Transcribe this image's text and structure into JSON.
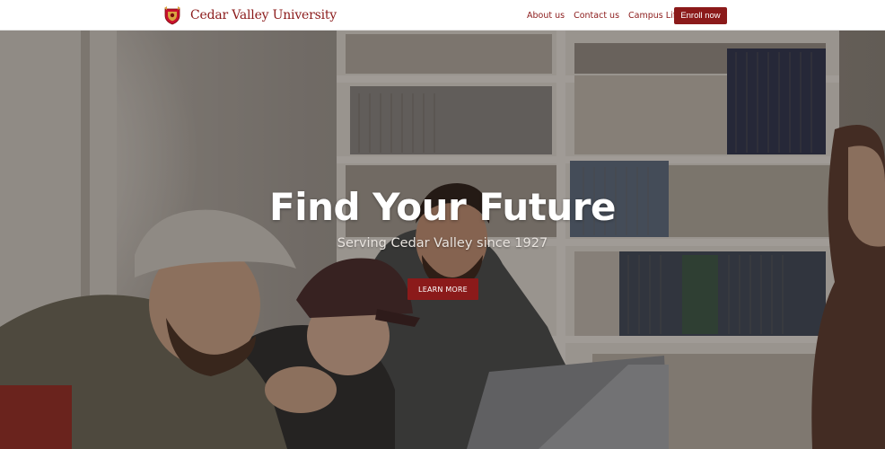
{
  "brand": {
    "name": "Cedar Valley University",
    "crest_color": "#c8102e",
    "accent": "#8b1a1a"
  },
  "nav": {
    "links": [
      "About us",
      "Contact us",
      "Campus Life"
    ],
    "enroll_label": "Enroll now"
  },
  "hero": {
    "title": "Find Your Future",
    "subtitle": "Serving Cedar Valley since 1927",
    "cta_label": "LEARN MORE",
    "background": "photo of students laughing around a laptop in a library"
  }
}
